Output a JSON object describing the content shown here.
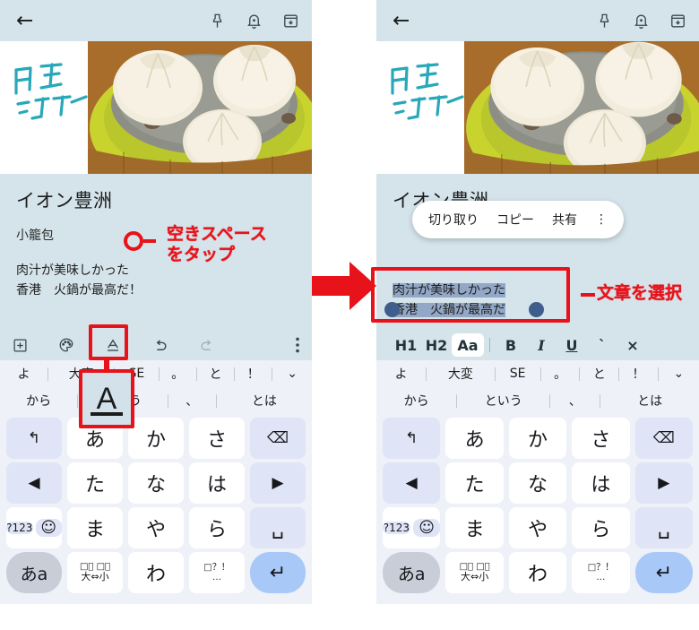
{
  "appbar": {
    "back_label": "←",
    "icons": [
      {
        "name": "pin-icon",
        "label": "pin"
      },
      {
        "name": "reminder-bell-icon",
        "label": "reminder"
      },
      {
        "name": "archive-icon",
        "label": "archive"
      }
    ]
  },
  "note": {
    "handwriting": "内式 ジュワー",
    "title": "イオン豊洲",
    "subtitle": "小籠包",
    "body_line1": "肉汁が美味しかった",
    "body_line2": "香港　火鍋が最高だ！",
    "body_line2_selected": "香港　火鍋が最高だ"
  },
  "toolbar": {
    "items": [
      {
        "name": "add-icon",
        "label": "add"
      },
      {
        "name": "palette-icon",
        "label": "palette"
      },
      {
        "name": "text-format-icon",
        "label": "A"
      },
      {
        "name": "undo-icon",
        "label": "undo"
      },
      {
        "name": "redo-icon",
        "label": "redo"
      },
      {
        "name": "more-options-icon",
        "label": "more"
      }
    ]
  },
  "format_bar": {
    "items": [
      "H1",
      "H2",
      "Aa",
      "B",
      "I",
      "U",
      "`",
      "×"
    ],
    "selected": "Aa"
  },
  "context_menu": {
    "cut": "切り取り",
    "copy": "コピー",
    "share": "共有",
    "more": "⋮"
  },
  "suggestions": {
    "row1": [
      "よ",
      "大変",
      "SE",
      "。",
      "と",
      "！"
    ],
    "row1_chevron": "⌄",
    "row2": [
      "から",
      "という",
      "、",
      "とは"
    ]
  },
  "keyboard": {
    "rows": [
      [
        {
          "name": "key-undo",
          "label": "↰",
          "type": "fn"
        },
        {
          "name": "key-a",
          "label": "あ",
          "type": "char"
        },
        {
          "name": "key-ka",
          "label": "か",
          "type": "char"
        },
        {
          "name": "key-sa",
          "label": "さ",
          "type": "char"
        },
        {
          "name": "key-backspace",
          "label": "⌫",
          "type": "fn"
        }
      ],
      [
        {
          "name": "key-cursor-left",
          "label": "◀",
          "type": "fn"
        },
        {
          "name": "key-ta",
          "label": "た",
          "type": "char"
        },
        {
          "name": "key-na",
          "label": "な",
          "type": "char"
        },
        {
          "name": "key-ha",
          "label": "は",
          "type": "char"
        },
        {
          "name": "key-cursor-right",
          "label": "▶",
          "type": "fn"
        }
      ],
      [
        {
          "name": "key-symbols-emoji",
          "label": "?123",
          "label2": "☺",
          "type": "dual"
        },
        {
          "name": "key-ma",
          "label": "ま",
          "type": "char"
        },
        {
          "name": "key-ya",
          "label": "や",
          "type": "char"
        },
        {
          "name": "key-ra",
          "label": "ら",
          "type": "char"
        },
        {
          "name": "key-space",
          "label": "␣",
          "type": "sp"
        }
      ],
      [
        {
          "name": "key-input-mode",
          "label": "あa",
          "type": "aA"
        },
        {
          "name": "key-dakuten",
          "label": "大⇔小",
          "type": "small"
        },
        {
          "name": "key-wa",
          "label": "わ",
          "type": "char"
        },
        {
          "name": "key-punctuation",
          "label": "?!",
          "type": "small"
        },
        {
          "name": "key-enter",
          "label": "↵",
          "type": "ent"
        }
      ]
    ]
  },
  "annotations": {
    "left_line1": "空きスペース",
    "left_line2": "をタップ",
    "right_text": "文章を選択",
    "magnified_letter": "A"
  },
  "colors": {
    "accent_red": "#e8121a",
    "appbar_bg": "#d5e4eb",
    "keyboard_bg": "#eef1f7",
    "selection_blue": "#93a8c6",
    "handle_blue": "#3f5e8c"
  }
}
